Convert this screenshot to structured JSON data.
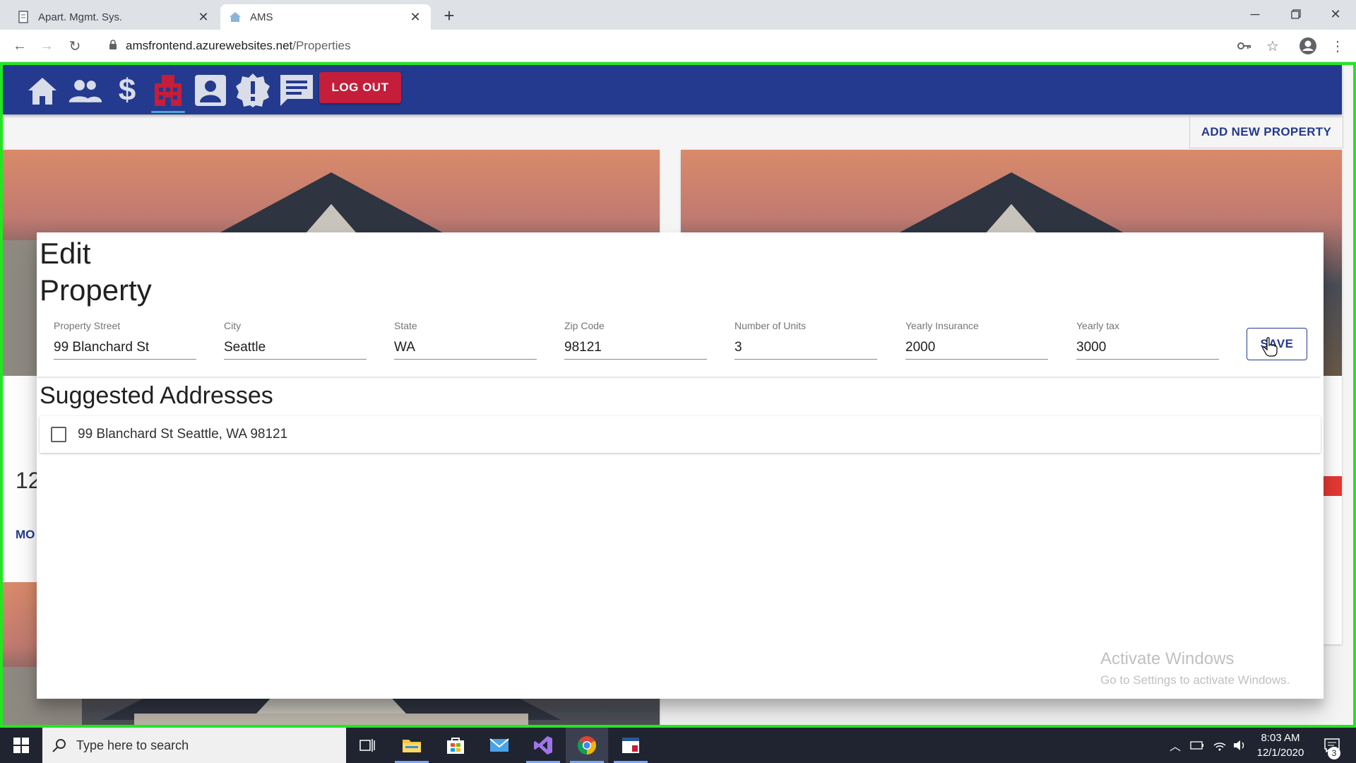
{
  "browser": {
    "tabs": [
      {
        "title": "Apart. Mgmt. Sys.",
        "active": false
      },
      {
        "title": "AMS",
        "active": true
      }
    ],
    "url_host": "amsfrontend.azurewebsites.net",
    "url_path": "/Properties"
  },
  "app": {
    "nav_icons": [
      "home-icon",
      "tenants-icon",
      "payments-icon",
      "properties-icon",
      "profile-icon",
      "alerts-icon",
      "messages-icon"
    ],
    "selected_nav": "properties-icon",
    "logout_label": "LOG OUT",
    "add_property_label": "ADD NEW PROPERTY",
    "background_card_title_partial": "12",
    "background_card_more_partial": "MO"
  },
  "dialog": {
    "title": "Edit Property",
    "fields": {
      "street": {
        "label": "Property Street",
        "value": "99 Blanchard St"
      },
      "city": {
        "label": "City",
        "value": "Seattle"
      },
      "state": {
        "label": "State",
        "value": "WA"
      },
      "zip": {
        "label": "Zip Code",
        "value": "98121"
      },
      "units": {
        "label": "Number of Units",
        "value": "3"
      },
      "insurance": {
        "label": "Yearly Insurance",
        "value": "2000"
      },
      "tax": {
        "label": "Yearly tax",
        "value": "3000"
      }
    },
    "save_label": "SAVE",
    "suggested_title": "Suggested Addresses",
    "suggestions": [
      {
        "text": "99 Blanchard St Seattle, WA 98121",
        "checked": false
      }
    ]
  },
  "watermark": {
    "line1": "Activate Windows",
    "line2": "Go to Settings to activate Windows."
  },
  "taskbar": {
    "search_placeholder": "Type here to search",
    "time": "8:03 AM",
    "date": "12/1/2020",
    "notification_count": "3"
  },
  "colors": {
    "appbar": "#243a8f",
    "logout": "#c41e3a",
    "frame_highlight": "#22e622"
  }
}
